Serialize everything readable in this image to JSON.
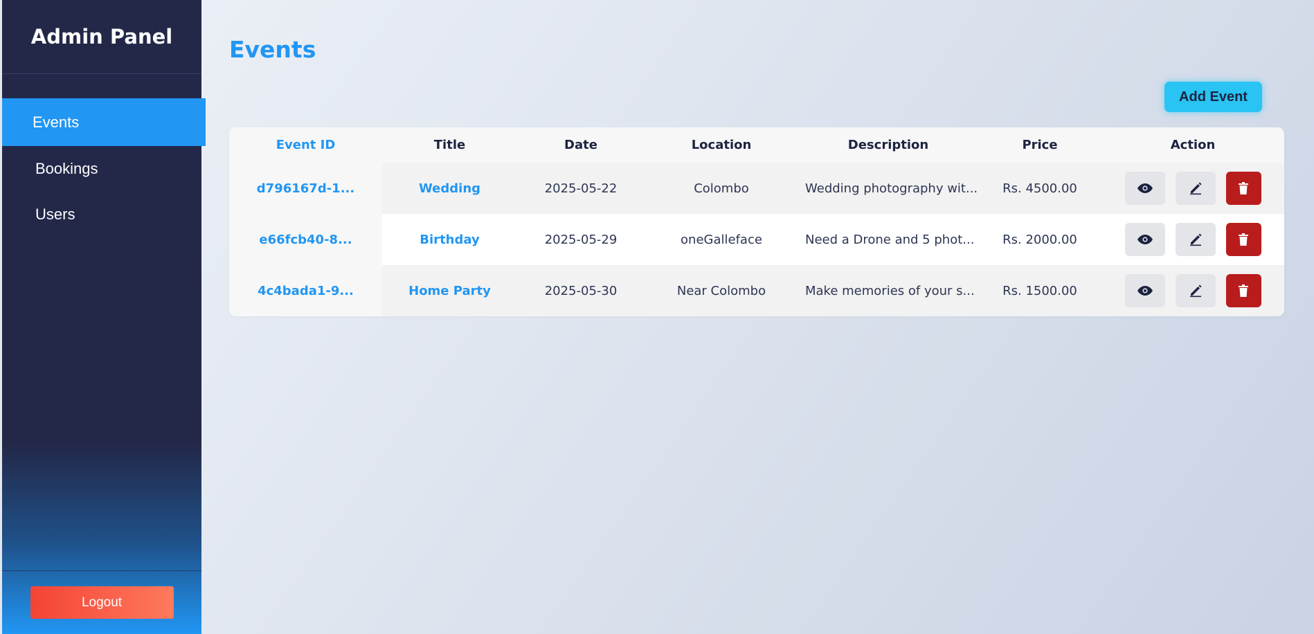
{
  "sidebar": {
    "brand": "Admin Panel",
    "items": [
      {
        "label": "Events",
        "active": true
      },
      {
        "label": "Bookings",
        "active": false
      },
      {
        "label": "Users",
        "active": false
      }
    ],
    "logout_label": "Logout"
  },
  "main": {
    "title": "Events",
    "add_button_label": "Add Event",
    "table": {
      "columns": [
        "Event ID",
        "Title",
        "Date",
        "Location",
        "Description",
        "Price",
        "Action"
      ],
      "rows": [
        {
          "id": "d796167d-1...",
          "title": "Wedding",
          "date": "2025-05-22",
          "location": "Colombo",
          "description": "Wedding photography wit...",
          "price": "Rs. 4500.00"
        },
        {
          "id": "e66fcb40-8...",
          "title": "Birthday",
          "date": "2025-05-29",
          "location": "oneGalleface",
          "description": "Need a Drone and 5 phot...",
          "price": "Rs. 2000.00"
        },
        {
          "id": "4c4bada1-9...",
          "title": "Home Party",
          "date": "2025-05-30",
          "location": "Near Colombo",
          "description": "Make memories of your s...",
          "price": "Rs. 1500.00"
        }
      ]
    }
  },
  "icons": {
    "view": "eye-icon",
    "edit": "pencil-icon",
    "delete": "trash-icon"
  },
  "colors": {
    "accent": "#2196f3",
    "sidebar_bg": "#232849",
    "delete_red": "#b91c1c",
    "add_button": "#29c4f3",
    "logout_gradient_start": "#f44336",
    "logout_gradient_end": "#ff7a5c"
  }
}
